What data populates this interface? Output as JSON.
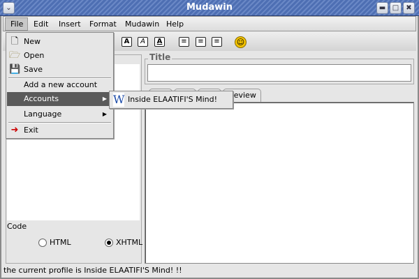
{
  "window": {
    "title": "Mudawin",
    "menu_icon": "chevron-down-icon",
    "minimize": "minimize-icon",
    "maximize": "maximize-icon",
    "close": "close-icon"
  },
  "menubar": [
    "File",
    "Edit",
    "Insert",
    "Format",
    "Mudawin",
    "Help"
  ],
  "toolbar": {
    "bold": "A",
    "italic": "A",
    "underline": "A",
    "icons": [
      "bold-icon",
      "italic-icon",
      "underline-icon",
      "align-center-icon",
      "align-left-icon",
      "align-right-icon",
      "smiley-icon"
    ]
  },
  "file_menu": {
    "new": "New",
    "open": "Open",
    "save": "Save",
    "add_account": "Add a new account",
    "accounts": "Accounts",
    "language": "Language",
    "exit": "Exit"
  },
  "accounts_submenu": [
    "Inside ELAATIFI'S Mind!"
  ],
  "left": {
    "code_label": "Code",
    "html": "HTML",
    "xhtml": "XHTML",
    "selected": "XHTML"
  },
  "editor": {
    "title_label": "Title",
    "title_value": "",
    "tabs": [
      "",
      "",
      "",
      "Preview"
    ]
  },
  "status": "the current profile is Inside ELAATIFI'S Mind! !!",
  "colors": {
    "titlebar": "#4e6fb3",
    "menu_highlight": "#5a5a5a"
  }
}
